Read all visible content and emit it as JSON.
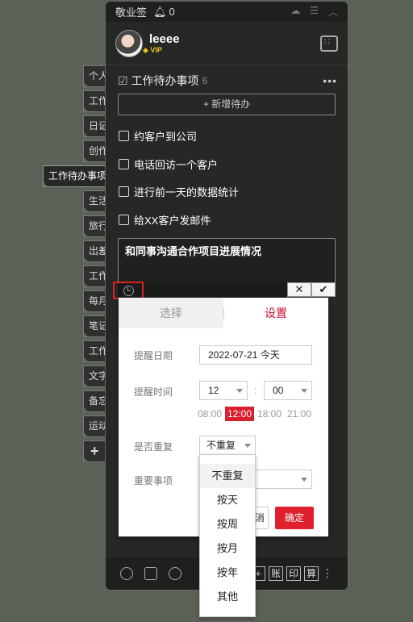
{
  "app": {
    "title": "敬业签",
    "notifications": "0"
  },
  "user": {
    "name": "leeee",
    "badge": "VIP"
  },
  "side_tabs": [
    "个人",
    "工作",
    "日记",
    "创作",
    "工作待办事项",
    "生活",
    "旅行",
    "出差",
    "工作",
    "每月",
    "笔记",
    "工作",
    "文字",
    "备忘",
    "运动",
    "+"
  ],
  "list": {
    "title": "工作待办事项",
    "count": "6",
    "more": "•••",
    "add_label": "+ 新增待办",
    "tasks": [
      "约客户到公司",
      "电话回访一个客户",
      "进行前一天的数据统计",
      "给XX客户发邮件"
    ],
    "editing_text": "和同事沟通合作项目进展情况"
  },
  "editor": {
    "cancel": "✕",
    "confirm": "✔"
  },
  "popup": {
    "tab_select": "选择",
    "tab_settings": "设置",
    "date_label": "提醒日期",
    "date_value": "2022-07-21 今天",
    "time_label": "提醒时间",
    "hour": "12",
    "minute": "00",
    "colon": ":",
    "time_options": [
      "08:00",
      "12:00",
      "18:00",
      "21:00"
    ],
    "repeat_label": "是否重复",
    "repeat_value": "不重复",
    "important_label": "重要事项",
    "cancel_fragment": "消",
    "confirm": "确定"
  },
  "repeat_options": [
    "不重复",
    "按天",
    "按周",
    "按月",
    "按年",
    "其他"
  ],
  "bottom_buttons": [
    "+",
    "账",
    "印",
    "算",
    "⋮"
  ],
  "colors": {
    "accent": "#e0202e",
    "panel": "#262825",
    "background": "#5a6157"
  }
}
